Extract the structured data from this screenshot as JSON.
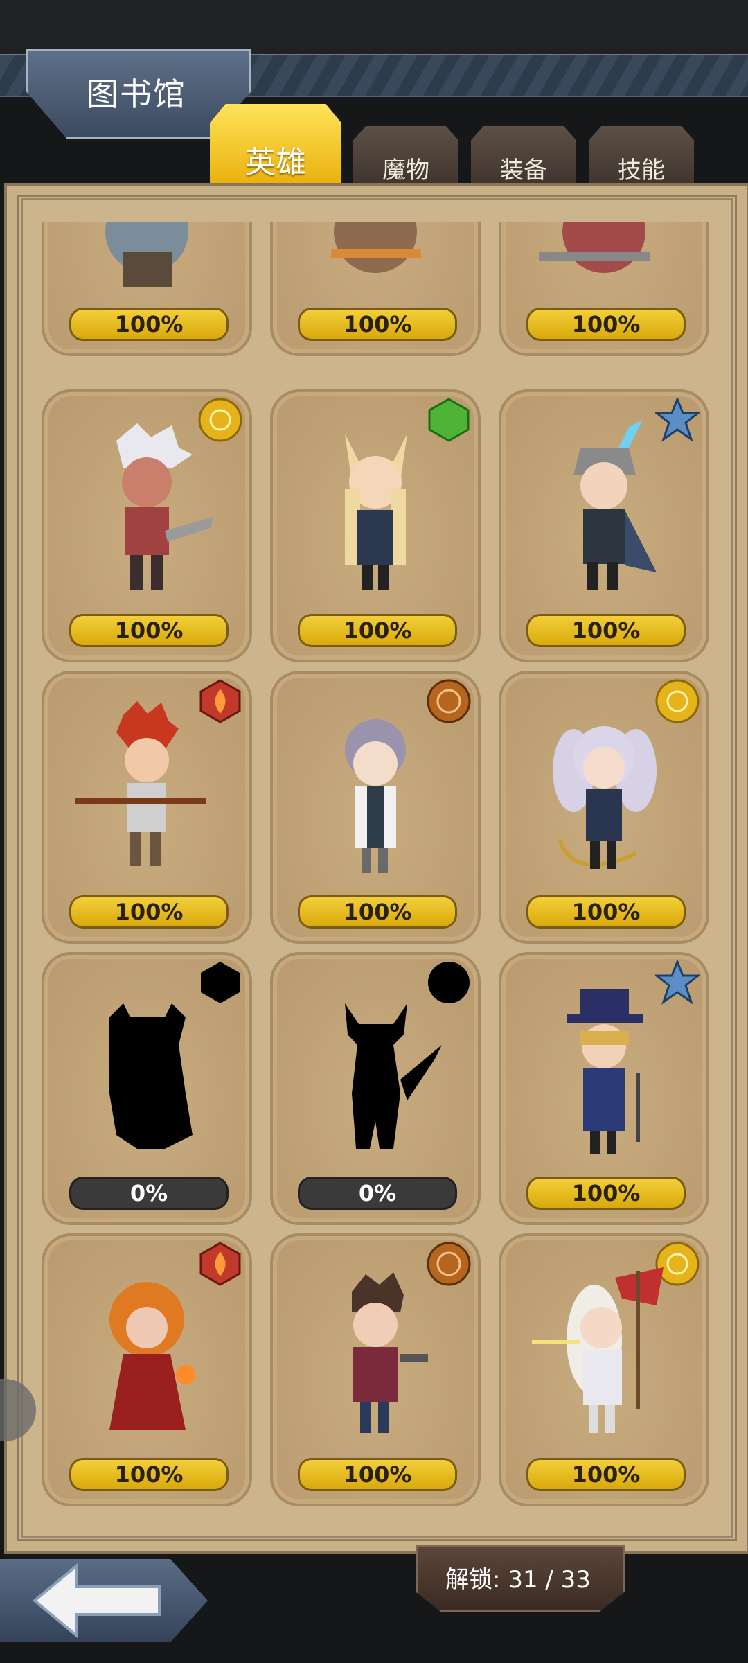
{
  "header": {
    "title": "图书馆"
  },
  "tabs": [
    {
      "label": "英雄",
      "active": true
    },
    {
      "label": "魔物",
      "active": false
    },
    {
      "label": "装备",
      "active": false
    },
    {
      "label": "技能",
      "active": false
    }
  ],
  "cards": [
    {
      "percent": "100%",
      "emblem": "none",
      "portrait": "hero-partial-1"
    },
    {
      "percent": "100%",
      "emblem": "none",
      "portrait": "hero-partial-2"
    },
    {
      "percent": "100%",
      "emblem": "none",
      "portrait": "hero-partial-3"
    },
    {
      "percent": "100%",
      "emblem": "gold-sun-icon",
      "portrait": "silver-hair-warrior"
    },
    {
      "percent": "100%",
      "emblem": "green-gem-icon",
      "portrait": "fox-girl"
    },
    {
      "percent": "100%",
      "emblem": "blue-star-icon",
      "portrait": "caped-swordsman"
    },
    {
      "percent": "100%",
      "emblem": "red-flame-icon",
      "portrait": "red-hair-lancer"
    },
    {
      "percent": "100%",
      "emblem": "bronze-seal-icon",
      "portrait": "white-coat-scholar"
    },
    {
      "percent": "100%",
      "emblem": "gold-sun-icon",
      "portrait": "twin-tail-reaper"
    },
    {
      "percent": "0%",
      "emblem": "black-hexagon-icon",
      "portrait": "locked-silhouette-1"
    },
    {
      "percent": "0%",
      "emblem": "black-circle-icon",
      "portrait": "locked-silhouette-2"
    },
    {
      "percent": "100%",
      "emblem": "blue-star-icon",
      "portrait": "top-hat-magician"
    },
    {
      "percent": "100%",
      "emblem": "red-flame-icon",
      "portrait": "fire-sorceress"
    },
    {
      "percent": "100%",
      "emblem": "bronze-seal-icon",
      "portrait": "gunslinger"
    },
    {
      "percent": "100%",
      "emblem": "gold-sun-icon",
      "portrait": "flag-bearer"
    }
  ],
  "footer": {
    "unlock_label": "解锁: 31 / 33"
  },
  "colors": {
    "gold": "#e7ae08",
    "panel": "#ccb48c",
    "card": "#b89a6e"
  }
}
